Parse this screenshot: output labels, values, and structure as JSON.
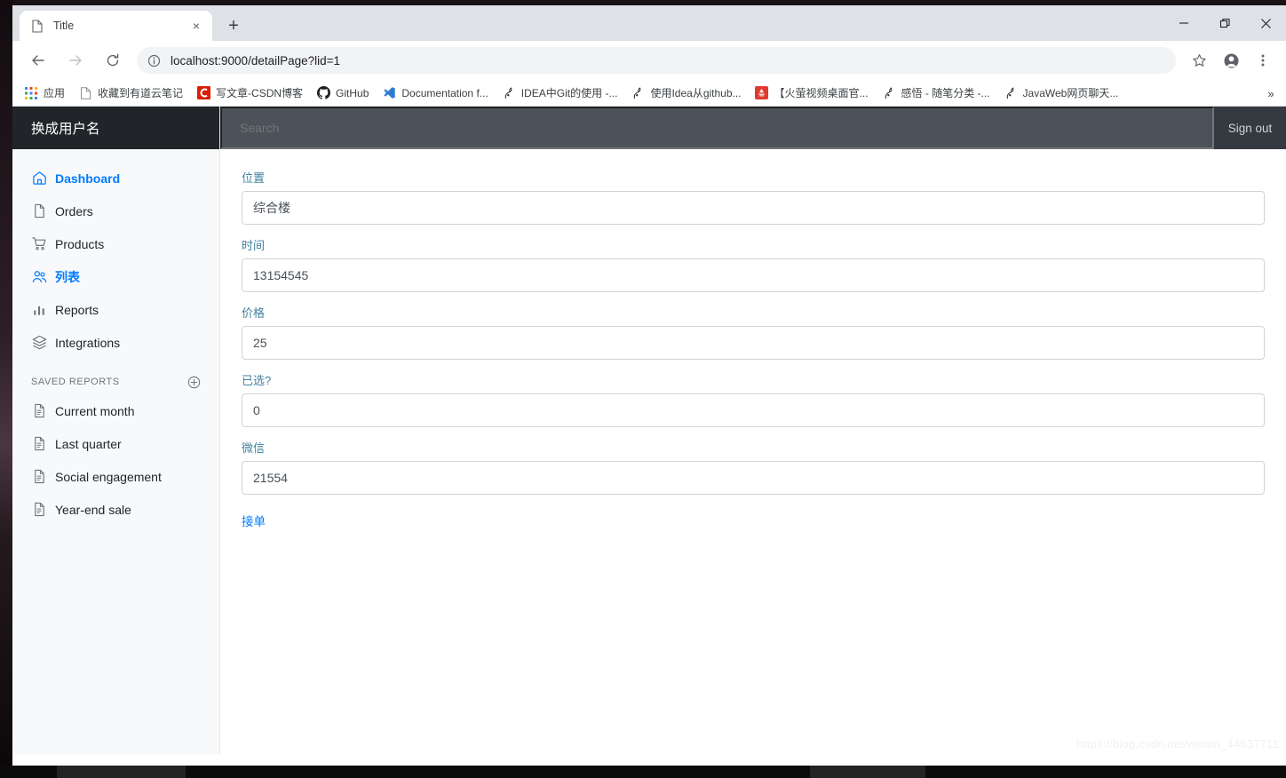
{
  "browser": {
    "tab": {
      "title": "Title",
      "favicon": "page-icon",
      "close": "×"
    },
    "newtab_label": "+",
    "window_controls": {
      "minimize": "—",
      "maximize": "❐",
      "close": "✕"
    },
    "nav": {
      "back": "←",
      "forward": "→",
      "reload": "↻"
    },
    "omnibox": {
      "info_icon": "info-icon",
      "url_scheme_host": "localhost:9000",
      "url_path": "/detailPage?lid=1",
      "url_full": "localhost:9000/detailPage?lid=1"
    },
    "toolbar_icons": {
      "bookmark_star": "star-icon",
      "profile": "profile-icon",
      "menu": "three-dot-menu-icon"
    },
    "bookmarks": [
      {
        "label": "应用",
        "icon": "apps-grid-icon"
      },
      {
        "label": "收藏到有道云笔记",
        "icon": "page-icon"
      },
      {
        "label": "写文章-CSDN博客",
        "icon": "csdn-icon"
      },
      {
        "label": "GitHub",
        "icon": "github-icon"
      },
      {
        "label": "Documentation f...",
        "icon": "vscode-icon"
      },
      {
        "label": "IDEA中Git的使用 -...",
        "icon": "cnblogs-icon"
      },
      {
        "label": "使用Idea从github...",
        "icon": "cnblogs-icon"
      },
      {
        "label": "【火萤视频桌面官...",
        "icon": "huoying-icon"
      },
      {
        "label": "感悟 - 随笔分类 -...",
        "icon": "cnblogs-icon"
      },
      {
        "label": "JavaWeb网页聊天...",
        "icon": "cnblogs-icon"
      }
    ],
    "bookmarks_overflow": "»"
  },
  "sidebar": {
    "brand": "换成用户名",
    "nav_items": [
      {
        "label": "Dashboard",
        "icon": "home-icon",
        "active": true
      },
      {
        "label": "Orders",
        "icon": "file-icon",
        "active": false
      },
      {
        "label": "Products",
        "icon": "cart-icon",
        "active": false
      },
      {
        "label": "列表",
        "icon": "users-icon",
        "active": true
      },
      {
        "label": "Reports",
        "icon": "bar-chart-icon",
        "active": false
      },
      {
        "label": "Integrations",
        "icon": "layers-icon",
        "active": false
      }
    ],
    "saved_reports_heading": "Saved reports",
    "saved_reports_add_icon": "plus-circle-icon",
    "saved_reports": [
      {
        "label": "Current month",
        "icon": "file-text-icon"
      },
      {
        "label": "Last quarter",
        "icon": "file-text-icon"
      },
      {
        "label": "Social engagement",
        "icon": "file-text-icon"
      },
      {
        "label": "Year-end sale",
        "icon": "file-text-icon"
      }
    ]
  },
  "topnav": {
    "search_placeholder": "Search",
    "search_value": "",
    "sign_out_label": "Sign out"
  },
  "form": {
    "fields": [
      {
        "label": "位置",
        "value": "综合楼",
        "name": "location-field"
      },
      {
        "label": "时间",
        "value": "13154545",
        "name": "time-field"
      },
      {
        "label": "价格",
        "value": "25",
        "name": "price-field"
      },
      {
        "label": "已选?",
        "value": "0",
        "name": "selected-field"
      },
      {
        "label": "微信",
        "value": "21554",
        "name": "wechat-field"
      }
    ],
    "submit_label": "接单"
  },
  "watermark": "https://blog.csdn.net/weixin_44637711",
  "colors": {
    "accent_link": "#007bff",
    "label_blue": "#41819e",
    "sidebar_bg": "#f8f9fa",
    "brand_bg": "#212529",
    "topnav_bg": "#343a40",
    "search_bg": "#4b5259"
  }
}
